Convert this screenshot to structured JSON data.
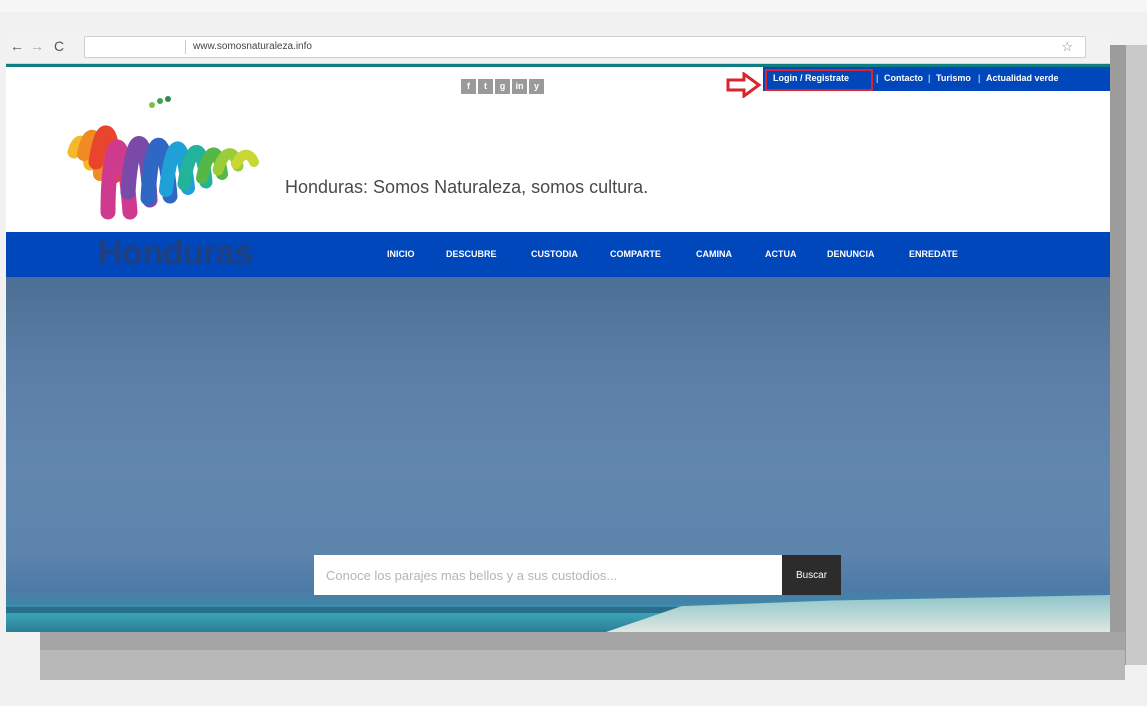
{
  "browser": {
    "url": "www.somosnaturaleza.info",
    "back_icon": "←",
    "forward_icon": "→",
    "reload_icon": "C",
    "star_icon": "☆"
  },
  "social_icons": [
    "f",
    "t",
    "g",
    "in",
    "y"
  ],
  "topnav": {
    "login": "Login / Registrate",
    "items": [
      "Contacto",
      "Turismo",
      "Actualidad verde"
    ],
    "separator": "|"
  },
  "logo": {
    "text": "Honduras"
  },
  "tagline": "Honduras: Somos Naturaleza, somos cultura.",
  "mainnav": {
    "items": [
      "INICIO",
      "DESCUBRE",
      "CUSTODIA",
      "COMPARTE",
      "CAMINA",
      "ACTUA",
      "DENUNCIA",
      "ENREDATE"
    ]
  },
  "search": {
    "placeholder": "Conoce los parajes mas bellos y a sus custodios...",
    "button_label": "Buscar"
  },
  "colors": {
    "nav_blue": "#0047bb",
    "accent_teal": "#0e7e83",
    "highlight_red": "#d9262e"
  }
}
